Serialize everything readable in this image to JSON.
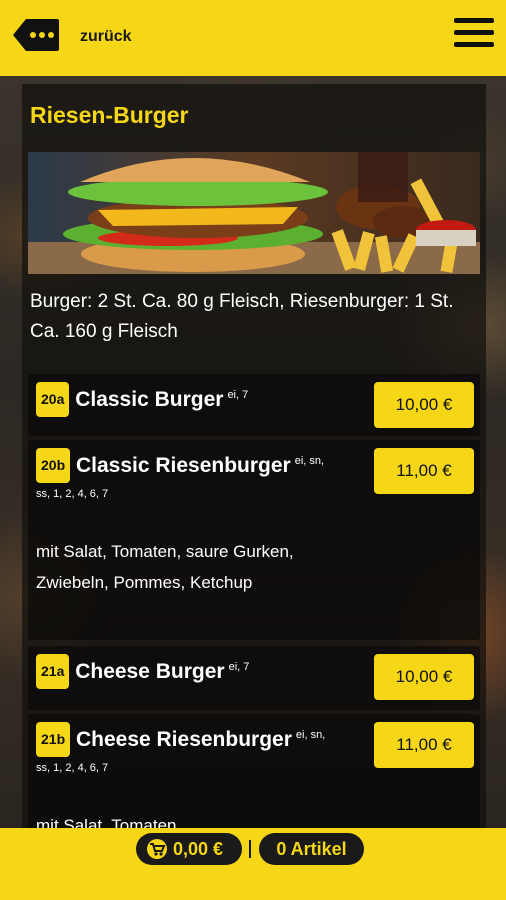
{
  "header": {
    "back_label": "zurück"
  },
  "category": {
    "title": "Riesen-Burger",
    "description": "Burger: 2 St. Ca. 80 g Fleisch, Riesenburger: 1 St. Ca. 160 g Fleisch"
  },
  "items": [
    {
      "number": "20a",
      "name": "Classic Burger",
      "allergens": "ei, 7",
      "description": "",
      "price": "10,00 €"
    },
    {
      "number": "20b",
      "name": "Classic Riesenburger",
      "allergens": "ei, sn, ss, 1, 2, 4, 6, 7",
      "description": "mit Salat, Tomaten, saure Gurken, Zwiebeln, Pommes, Ketchup",
      "price": "11,00 €"
    },
    {
      "number": "21a",
      "name": "Cheese Burger",
      "allergens": "ei, 7",
      "description": "",
      "price": "10,00 €"
    },
    {
      "number": "21b",
      "name": "Cheese Riesenburger",
      "allergens": "ei, sn, ss, 1, 2, 4, 6, 7",
      "description": "mit Salat, Tomaten",
      "price": "11,00 €"
    }
  ],
  "footer": {
    "cart_total": "0,00 €",
    "item_count": "0 Artikel"
  },
  "colors": {
    "accent": "#f5d717",
    "dark": "#1a1a1a"
  },
  "icons": {
    "back": "dots-back-icon",
    "menu": "hamburger-menu-icon",
    "cart": "cart-icon"
  }
}
